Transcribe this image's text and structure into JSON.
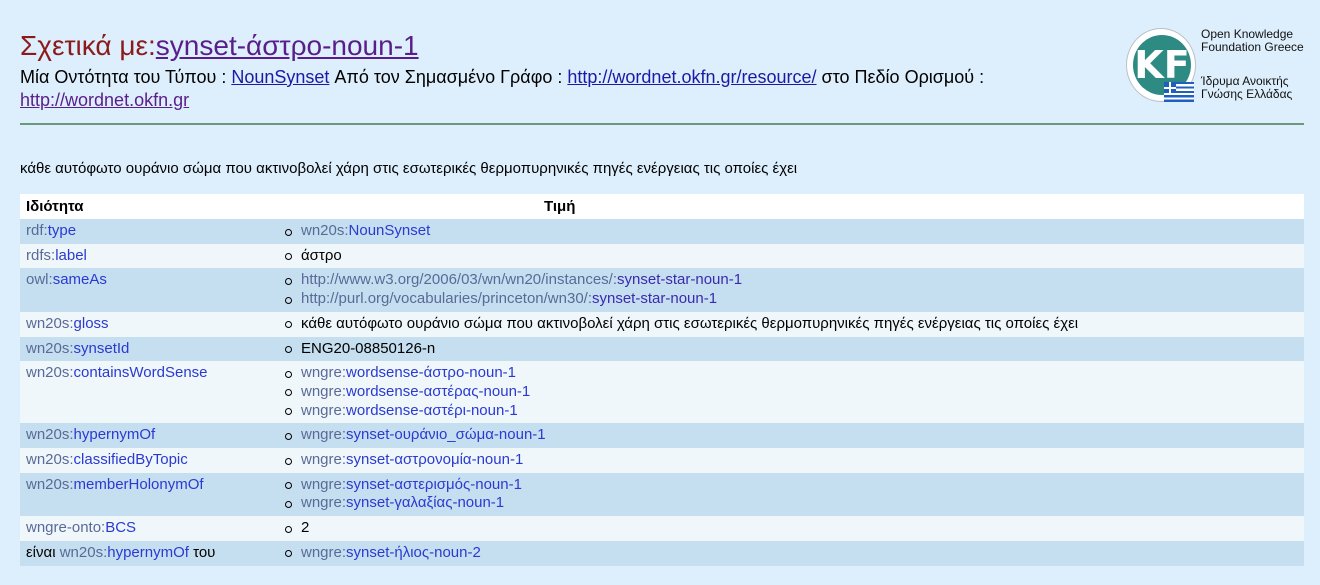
{
  "header": {
    "title_prefix": "Σχετικά με:",
    "title_link": "synset-άστρο-noun-1",
    "sub_1": "Μία Οντότητα του Τύπου : ",
    "sub_type_link": "NounSynset",
    "sub_2": " Από τον Σημασμένο Γράφο : ",
    "sub_graph_link": "http://wordnet.okfn.gr/resource/",
    "sub_3": " στο Πεδίο Ορισμού : ",
    "sub_domain_link": "http://wordnet.okfn.gr"
  },
  "logo": {
    "letters": "KF",
    "line1": "Open Knowledge",
    "line2": "Foundation Greece",
    "line3": "Ίδρυμα Ανοικτής",
    "line4": "Γνώσης Ελλάδας"
  },
  "description": "κάθε αυτόφωτο ουράνιο σώμα που ακτινοβολεί χάρη στις εσωτερικές θερμοπυρηνικές πηγές ενέργειας τις οποίες έχει",
  "table": {
    "col_property": "Ιδιότητα",
    "col_value": "Τιμή",
    "rows": [
      {
        "p_pre": "rdf:",
        "p_loc": "type",
        "values": [
          {
            "pre": "wn20s:",
            "loc": "NounSynset"
          }
        ]
      },
      {
        "p_pre": "rdfs:",
        "p_loc": "label",
        "values": [
          {
            "text": "άστρο"
          }
        ]
      },
      {
        "p_pre": "owl:",
        "p_loc": "sameAs",
        "values": [
          {
            "url": "http://www.w3.org/2006/03/wn/wn20/instances/:",
            "loc": "synset-star-noun-1"
          },
          {
            "url": "http://purl.org/vocabularies/princeton/wn30/:",
            "loc": "synset-star-noun-1"
          }
        ]
      },
      {
        "p_pre": "wn20s:",
        "p_loc": "gloss",
        "values": [
          {
            "text": "κάθε αυτόφωτο ουράνιο σώμα που ακτινοβολεί χάρη στις εσωτερικές θερμοπυρηνικές πηγές ενέργειας τις οποίες έχει"
          }
        ]
      },
      {
        "p_pre": "wn20s:",
        "p_loc": "synsetId",
        "values": [
          {
            "text": "ENG20-08850126-n"
          }
        ]
      },
      {
        "p_pre": "wn20s:",
        "p_loc": "containsWordSense",
        "values": [
          {
            "pre": "wngre:",
            "loc": "wordsense-άστρο-noun-1"
          },
          {
            "pre": "wngre:",
            "loc": "wordsense-αστέρας-noun-1"
          },
          {
            "pre": "wngre:",
            "loc": "wordsense-αστέρι-noun-1"
          }
        ]
      },
      {
        "p_pre": "wn20s:",
        "p_loc": "hypernymOf",
        "values": [
          {
            "pre": "wngre:",
            "loc": "synset-ουράνιο_σώμα-noun-1"
          }
        ]
      },
      {
        "p_pre": "wn20s:",
        "p_loc": "classifiedByTopic",
        "values": [
          {
            "pre": "wngre:",
            "loc": "synset-αστρονομία-noun-1"
          }
        ]
      },
      {
        "p_pre": "wn20s:",
        "p_loc": "memberHolonymOf",
        "values": [
          {
            "pre": "wngre:",
            "loc": "synset-αστερισμός-noun-1"
          },
          {
            "pre": "wngre:",
            "loc": "synset-γαλαξίας-noun-1"
          }
        ]
      },
      {
        "p_pre": "wngre-onto:",
        "p_loc": "BCS",
        "values": [
          {
            "text": "2"
          }
        ]
      },
      {
        "p_lead": "είναι ",
        "p_pre": "wn20s:",
        "p_loc": "hypernymOf",
        "p_trail": " του",
        "values": [
          {
            "pre": "wngre:",
            "loc": "synset-ήλιος-noun-2"
          }
        ]
      }
    ]
  }
}
